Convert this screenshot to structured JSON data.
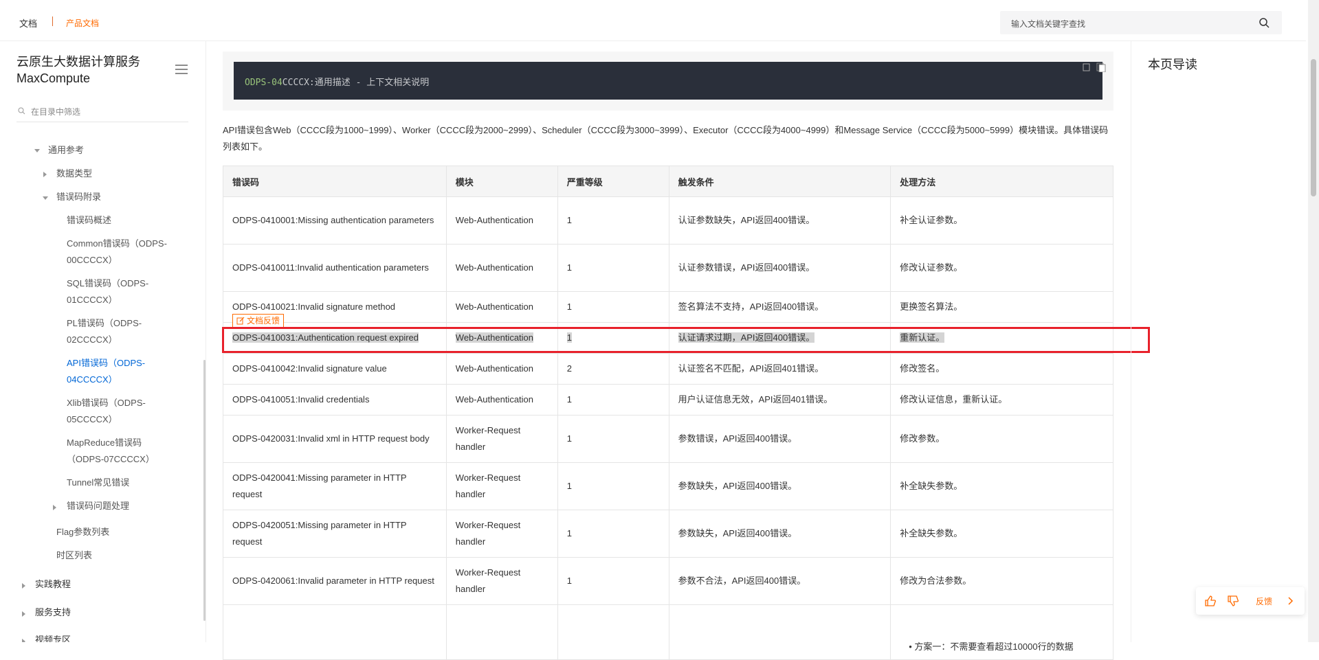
{
  "topbar": {
    "crumb1": "文档",
    "crumb2": "产品文档",
    "search_placeholder": "输入文档关键字查找"
  },
  "sidebar": {
    "title_line1": "云原生大数据计算服务",
    "title_line2": "MaxCompute",
    "filter_placeholder": "在目录中筛选",
    "items": [
      {
        "label": "通用参考"
      },
      {
        "label": "数据类型"
      },
      {
        "label": "错误码附录"
      },
      {
        "label": "错误码概述"
      },
      {
        "label": "Common错误码（ODPS-"
      },
      {
        "label": "00CCCCX）"
      },
      {
        "label": "SQL错误码（ODPS-"
      },
      {
        "label": "01CCCCX）"
      },
      {
        "label": "PL错误码（ODPS-"
      },
      {
        "label": "02CCCCX）"
      },
      {
        "label": "API错误码（ODPS-"
      },
      {
        "label": "04CCCCX）"
      },
      {
        "label": "Xlib错误码（ODPS-"
      },
      {
        "label": "05CCCCX）"
      },
      {
        "label": "MapReduce错误码"
      },
      {
        "label": "（ODPS-07CCCCX）"
      },
      {
        "label": "Tunnel常见错误"
      },
      {
        "label": "错误码问题处理"
      },
      {
        "label": "Flag参数列表"
      },
      {
        "label": "时区列表"
      },
      {
        "label": "实践教程"
      },
      {
        "label": "服务支持"
      },
      {
        "label": "视频专区"
      }
    ]
  },
  "main": {
    "code_prefix": "ODPS-04",
    "code_rest": "CCCCX:通用描述 - 上下文相关说明",
    "paragraph": "API错误包含Web（CCCC段为1000~1999）、Worker（CCCC段为2000~2999）、Scheduler（CCCC段为3000~3999）、Executor（CCCC段为4000~4999）和Message Service（CCCC段为5000~5999）模块错误。具体错误码列表如下。",
    "feedback_tag": "文档反馈",
    "table": {
      "headers": [
        "错误码",
        "模块",
        "严重等级",
        "触发条件",
        "处理方法"
      ],
      "rows": [
        [
          "ODPS-0410001:Missing authentication parameters",
          "Web-Authentication",
          "1",
          "认证参数缺失，API返回400错误。",
          "补全认证参数。"
        ],
        [
          "ODPS-0410011:Invalid authentication parameters",
          "Web-Authentication",
          "1",
          "认证参数错误，API返回400错误。",
          "修改认证参数。"
        ],
        [
          "ODPS-0410021:Invalid signature method",
          "Web-Authentication",
          "1",
          "签名算法不支持，API返回400错误。",
          "更换签名算法。"
        ],
        [
          "ODPS-0410031:Authentication request expired",
          "Web-Authentication",
          "1",
          "认证请求过期，API返回400错误。",
          "重新认证。"
        ],
        [
          "ODPS-0410042:Invalid signature value",
          "Web-Authentication",
          "2",
          "认证签名不匹配，API返回401错误。",
          "修改签名。"
        ],
        [
          "ODPS-0410051:Invalid credentials",
          "Web-Authentication",
          "1",
          "用户认证信息无效，API返回401错误。",
          "修改认证信息，重新认证。"
        ],
        [
          "ODPS-0420031:Invalid xml in HTTP request body",
          "Worker-Request handler",
          "1",
          "参数错误，API返回400错误。",
          "修改参数。"
        ],
        [
          "ODPS-0420041:Missing parameter in HTTP request",
          "Worker-Request handler",
          "1",
          "参数缺失，API返回400错误。",
          "补全缺失参数。"
        ],
        [
          "ODPS-0420051:Missing parameter in HTTP request",
          "Worker-Request handler",
          "1",
          "参数缺失，API返回400错误。",
          "补全缺失参数。"
        ],
        [
          "ODPS-0420061:Invalid parameter in HTTP request",
          "Worker-Request handler",
          "1",
          "参数不合法，API返回400错误。",
          "修改为合法参数。"
        ],
        [
          "",
          "",
          "",
          "",
          "方案一：不需要查看超过10000行的数据"
        ]
      ]
    }
  },
  "toc": {
    "title": "本页导读"
  },
  "float_bar": {
    "feedback_label": "反馈"
  }
}
